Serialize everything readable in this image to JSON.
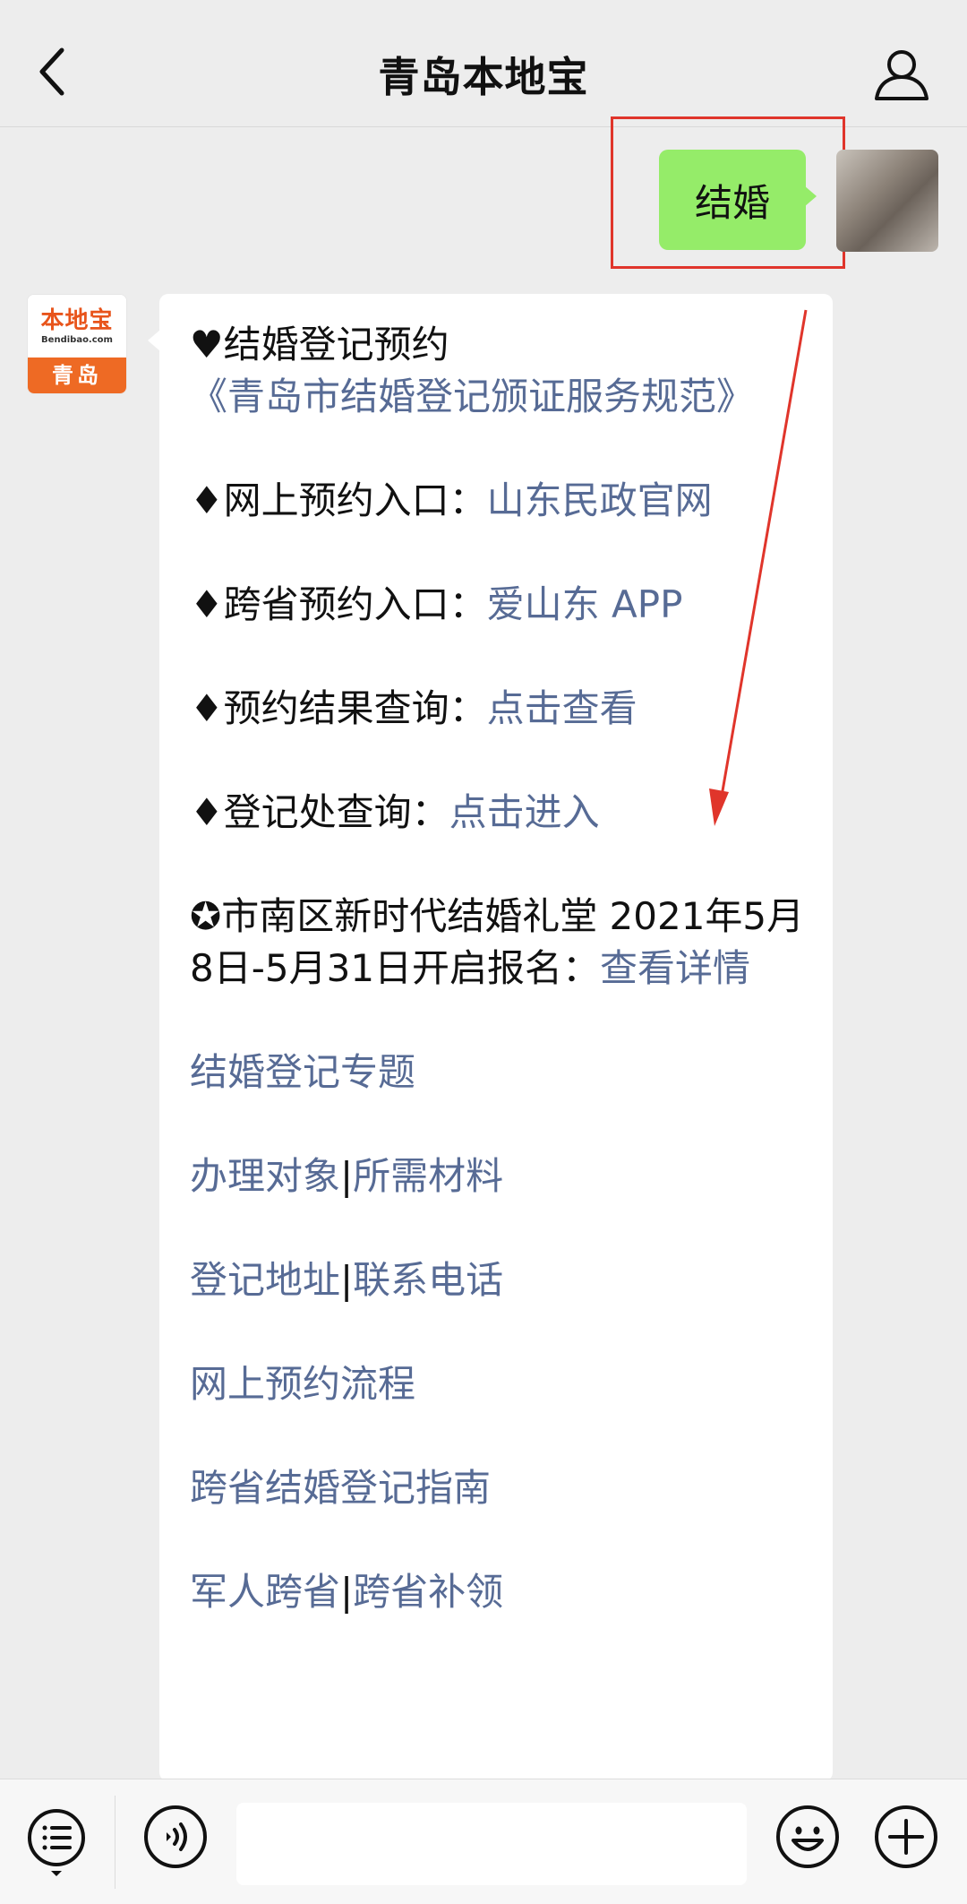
{
  "header": {
    "title": "青岛本地宝",
    "back_icon": "chevron-left-icon",
    "profile_icon": "person-icon"
  },
  "user_message": {
    "text": "结婚"
  },
  "bot_avatar": {
    "logo_text": "本地宝",
    "logo_domain": "Bendibao.com",
    "city": "青岛"
  },
  "bot_message": {
    "title": "♥结婚登记预约",
    "title_link": "《青岛市结婚登记颁证服务规范》",
    "online_label": "♦网上预约入口：",
    "online_link": "山东民政官网",
    "cross_label": "♦跨省预约入口：",
    "cross_link": "爱山东 APP",
    "result_label": "♦预约结果查询：",
    "result_link": "点击查看",
    "office_label": "♦登记处查询：",
    "office_link": "点击进入",
    "hall_text": "✪市南区新时代结婚礼堂 2021年5月8日-5月31日开启报名：",
    "hall_link": "查看详情",
    "links": [
      {
        "a": "结婚登记专题",
        "sep": "",
        "b": ""
      },
      {
        "a": "办理对象",
        "sep": "|",
        "b": "所需材料"
      },
      {
        "a": "登记地址",
        "sep": "|",
        "b": "联系电话"
      },
      {
        "a": "网上预约流程",
        "sep": "",
        "b": ""
      },
      {
        "a": "跨省结婚登记指南",
        "sep": "",
        "b": ""
      },
      {
        "a": "军人跨省",
        "sep": "|",
        "b": "跨省补领"
      }
    ]
  },
  "bottom_bar": {
    "menu_icon": "list-menu-icon",
    "voice_icon": "voice-icon",
    "emoji_icon": "smiley-icon",
    "plus_icon": "plus-icon"
  },
  "colors": {
    "background": "#ededed",
    "user_bubble": "#95ec69",
    "link": "#576b95",
    "highlight": "#e0352b",
    "brand_orange": "#ee6a24"
  }
}
